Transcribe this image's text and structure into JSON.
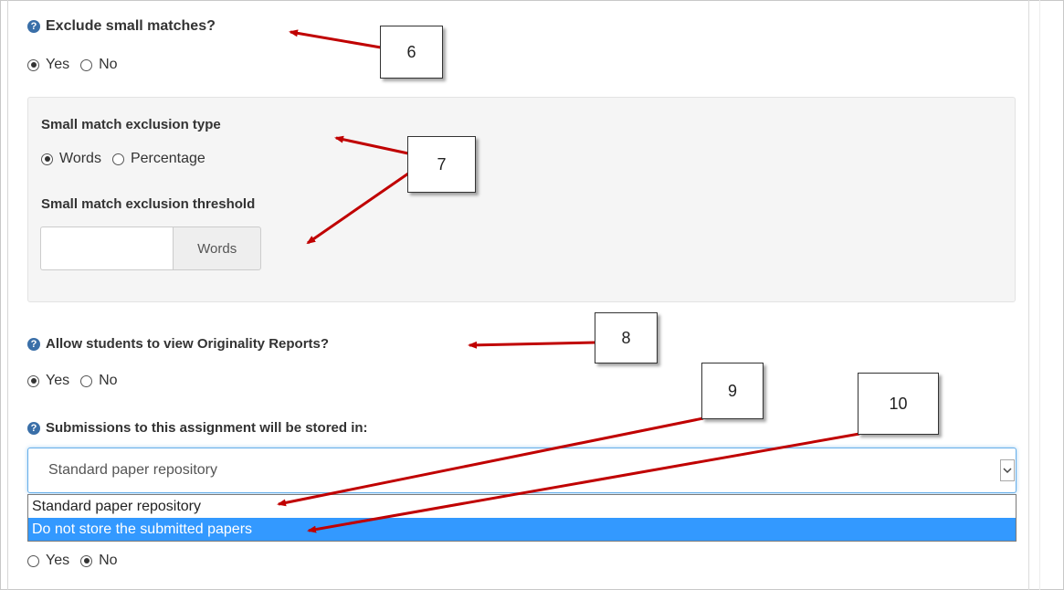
{
  "exclude_small": {
    "label": "Exclude small matches?",
    "options": [
      "Yes",
      "No"
    ],
    "selected": "Yes"
  },
  "exclusion_type": {
    "label": "Small match exclusion type",
    "options": [
      "Words",
      "Percentage"
    ],
    "selected": "Words"
  },
  "exclusion_threshold": {
    "label": "Small match exclusion threshold",
    "value": "",
    "addon": "Words"
  },
  "originality": {
    "label": "Allow students to view Originality Reports?",
    "options": [
      "Yes",
      "No"
    ],
    "selected": "Yes"
  },
  "repository": {
    "label": "Submissions to this assignment will be stored in:",
    "selected_value": "Standard paper repository",
    "options": [
      "Standard paper repository",
      "Do not store the submitted papers"
    ],
    "highlighted": "Do not store the submitted papers"
  },
  "bottom_radio": {
    "options": [
      "Yes",
      "No"
    ],
    "selected": "No"
  },
  "callouts": [
    "6",
    "7",
    "8",
    "9",
    "10"
  ],
  "colors": {
    "arrow": "#c00000",
    "help_icon": "#3a6fa8",
    "select_focus": "#66afe9",
    "option_highlight": "#3399ff"
  },
  "icons": {
    "help": "question-circle-icon",
    "caret": "chevron-down-icon"
  }
}
